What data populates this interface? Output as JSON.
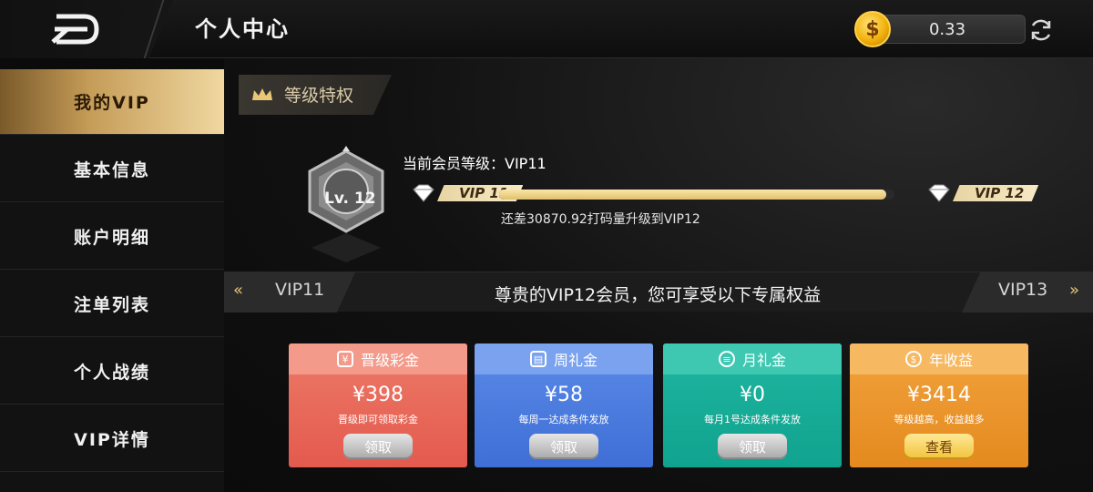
{
  "header": {
    "title": "个人中心",
    "balance": "0.33",
    "coin_symbol": "$"
  },
  "sidebar": {
    "items": [
      {
        "label": "我的VIP",
        "active": true
      },
      {
        "label": "基本信息"
      },
      {
        "label": "账户明细"
      },
      {
        "label": "注单列表"
      },
      {
        "label": "个人战绩"
      },
      {
        "label": "VIP详情"
      }
    ]
  },
  "vip": {
    "section_title": "等级特权",
    "badge_level": "Lv. 12",
    "current_level_text": "当前会员等级：VIP11",
    "from_tier": "VIP 11",
    "to_tier": "VIP 12",
    "progress_fraction": 0.98,
    "progress_note": "还差30870.92打码量升级到VIP12"
  },
  "tiers": {
    "prev": "VIP11",
    "next": "VIP13",
    "prev_chevron": "«",
    "next_chevron": "»",
    "headline": "尊贵的VIP12会员，您可享受以下专属权益"
  },
  "cards": [
    {
      "title": "晋级彩金",
      "icon": "money-bag-icon",
      "amount": "¥398",
      "desc": "晋级即可领取彩金",
      "button": "领取"
    },
    {
      "title": "周礼金",
      "icon": "gift-icon",
      "amount": "¥58",
      "desc": "每周一达成条件发放",
      "button": "领取"
    },
    {
      "title": "月礼金",
      "icon": "coins-stack-icon",
      "amount": "¥0",
      "desc": "每月1号达成条件发放",
      "button": "领取"
    },
    {
      "title": "年收益",
      "icon": "coin-icon",
      "amount": "¥3414",
      "desc": "等级越高，收益越多",
      "button": "查看"
    }
  ],
  "colors": {
    "gold_accent": "#e8c878",
    "card_red": "#e45a4e",
    "card_blue": "#3f6fd6",
    "card_teal": "#10a38f",
    "card_orange": "#e48a1e"
  }
}
